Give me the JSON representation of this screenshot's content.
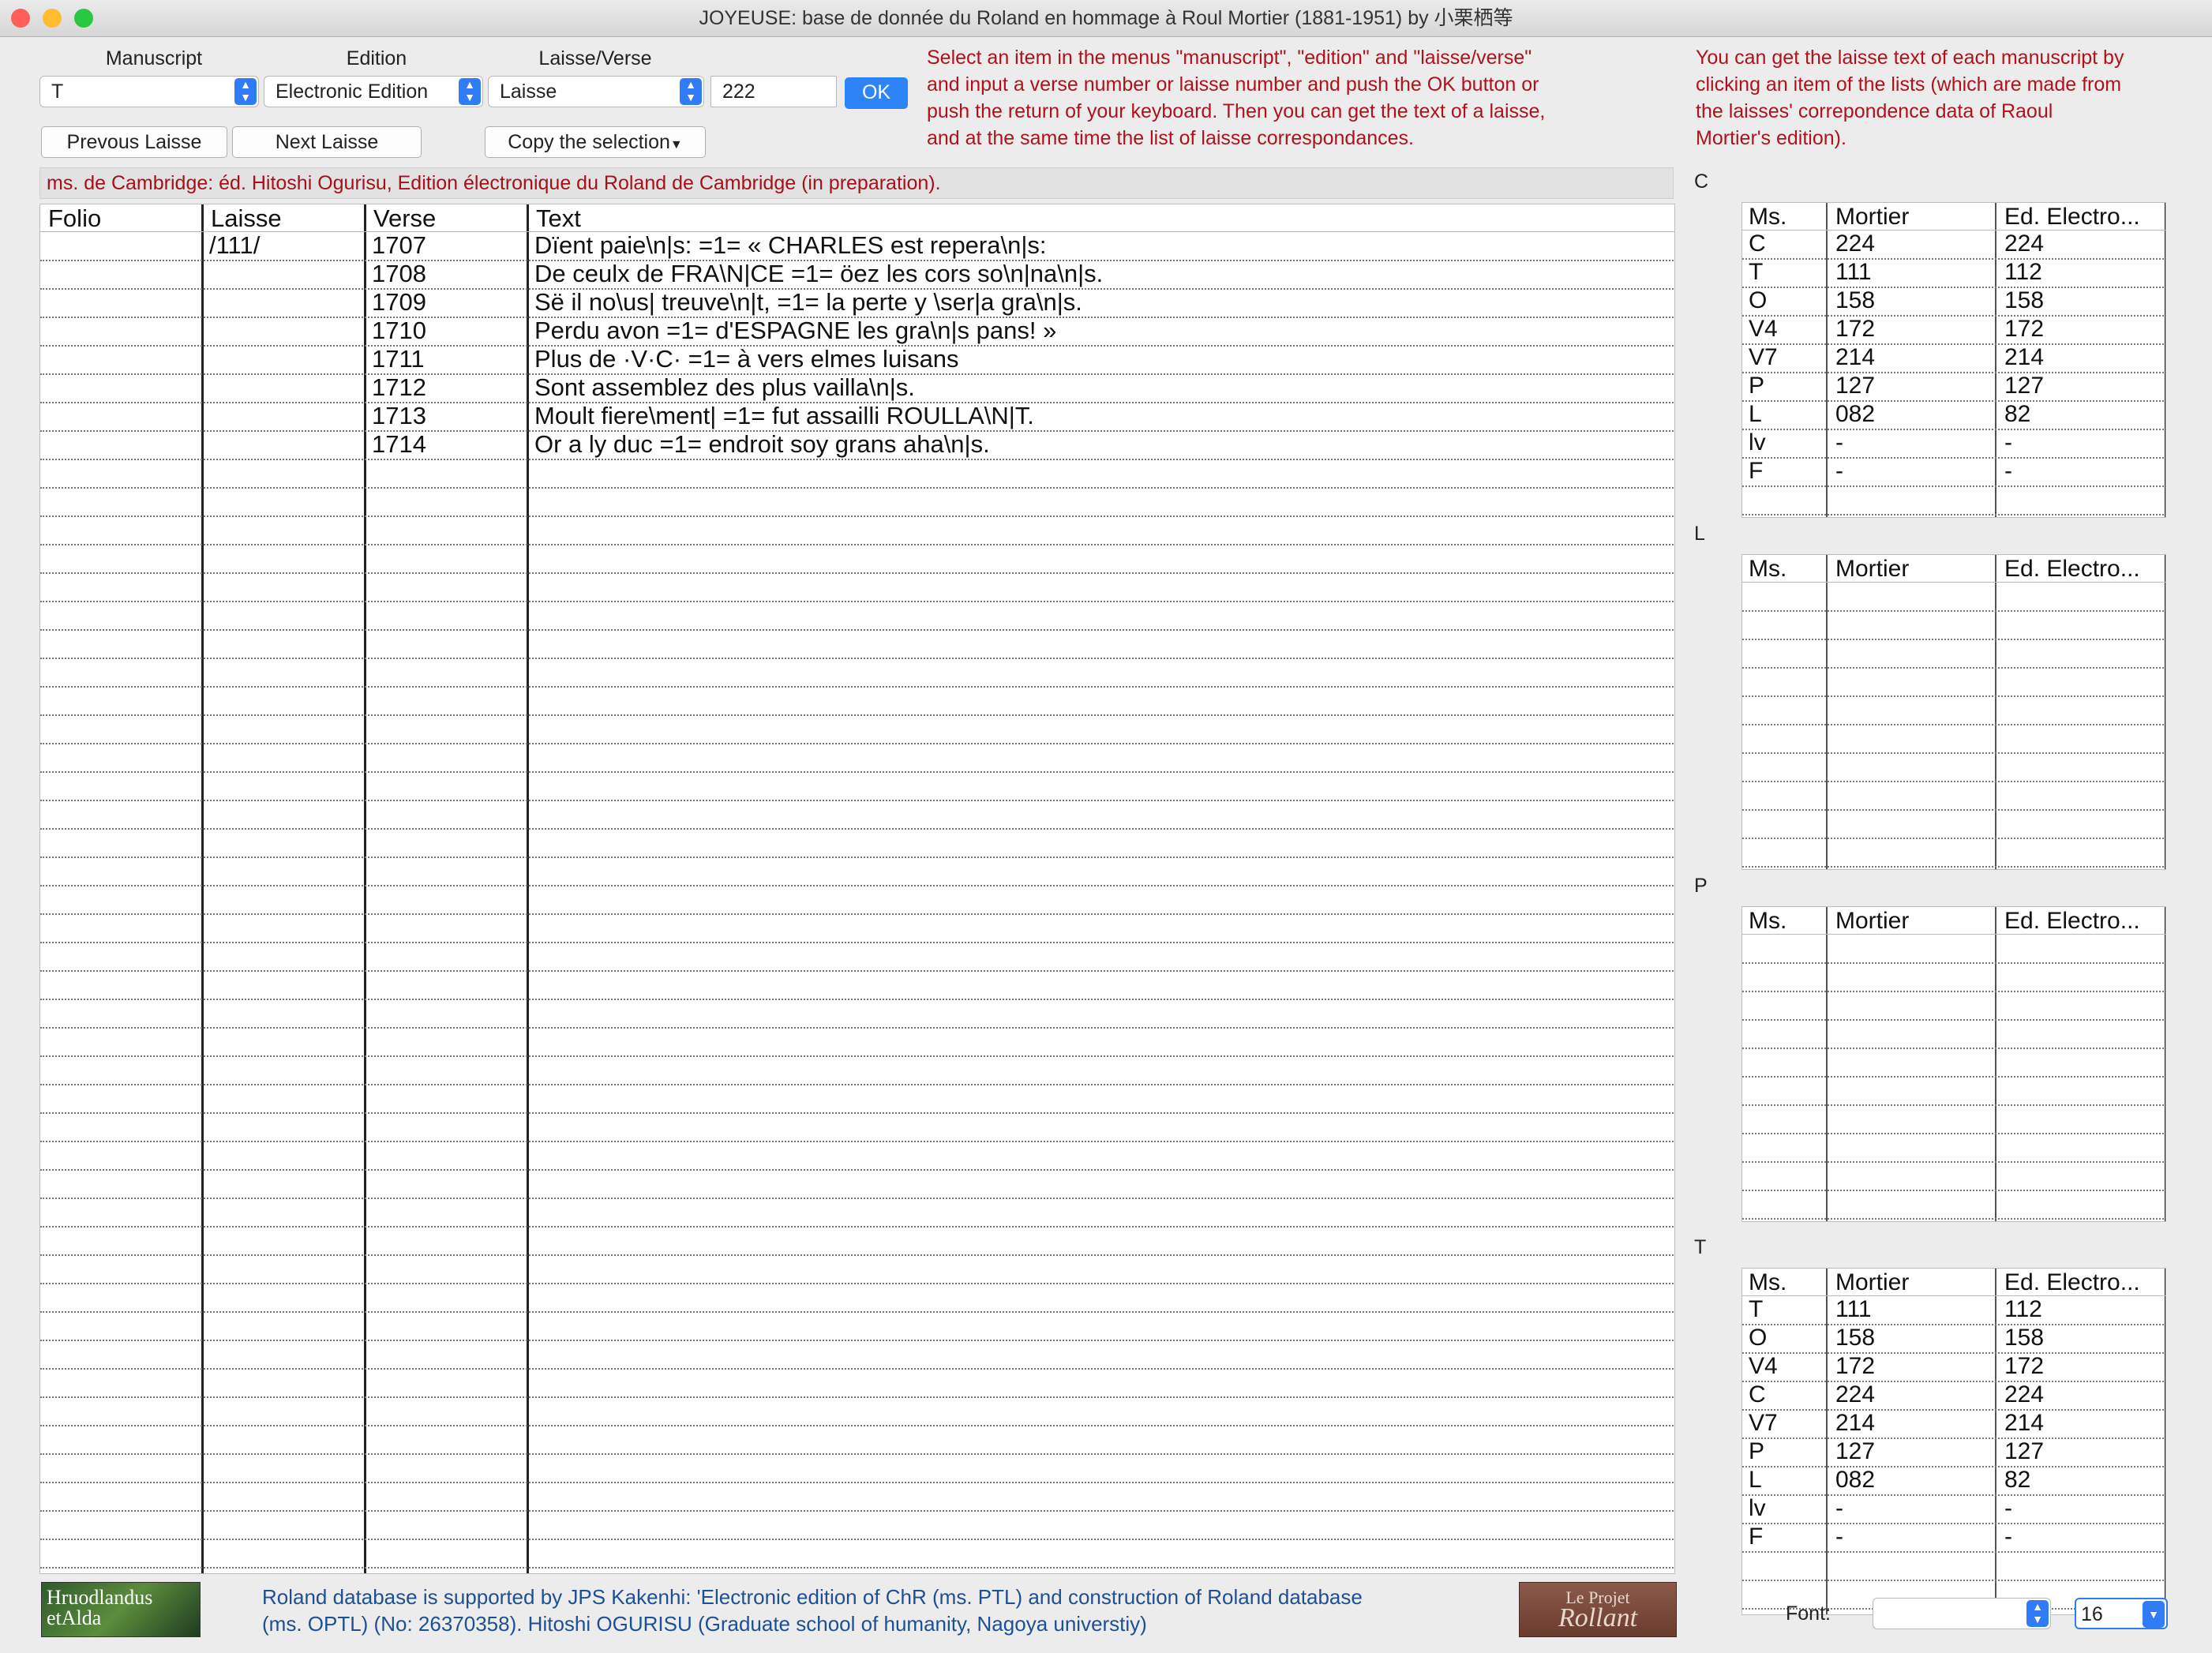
{
  "window": {
    "title": "JOYEUSE: base de donnée du Roland en hommage à Roul Mortier (1881-1951) by 小栗栖等",
    "traffic_colors": [
      "#fe5f57",
      "#febc2e",
      "#28c840"
    ]
  },
  "controls": {
    "manuscript_label": "Manuscript",
    "manuscript_value": "T",
    "edition_label": "Edition",
    "edition_value": "Electronic Edition",
    "laisse_label": "Laisse/Verse",
    "laisse_value": "Laisse",
    "number_value": "222",
    "ok_label": "OK",
    "prev_label": "Prevous Laisse",
    "next_label": "Next Laisse",
    "copy_label": "Copy the selection"
  },
  "help": {
    "left": [
      "Select an item in the menus \"manuscript\",  \"edition\" and \"laisse/verse\"",
      "and input a verse number or laisse number and push the OK button or",
      "push the return of your keyboard. Then you can get the text of a laisse,",
      "and at the same time the list of laisse correspondances."
    ],
    "right": [
      "You can get the laisse text of each manuscript by",
      "clicking an item of the lists (which are made from",
      "the laisses' correpondence data of Raoul",
      "Mortier's edition)."
    ]
  },
  "source": "ms. de Cambridge: éd. Hitoshi Ogurisu, Edition électronique du Roland de Cambridge (in preparation).",
  "table": {
    "headers": [
      "Folio",
      "Laisse",
      "Verse",
      "Text"
    ],
    "rows": [
      [
        "",
        "/111/",
        "1707",
        "Dïent paie\\n|s:  =1= « CHARLES est repera\\n|s:"
      ],
      [
        "",
        "",
        "1708",
        "De ceulx de FRA\\N|CE =1=  öez les cors so\\n|na\\n|s."
      ],
      [
        "",
        "",
        "1709",
        "Së il no\\us| treuve\\n|t, =1=  la perte y \\ser|a gra\\n|s."
      ],
      [
        "",
        "",
        "1710",
        "Perdu avon  =1= d'ESPAGNE les gra\\n|s pans! »"
      ],
      [
        "",
        "",
        "1711",
        "Plus de ·V·C· =1=  à vers elmes luisans"
      ],
      [
        "",
        "",
        "1712",
        "Sont assemblez des plus vailla\\n|s."
      ],
      [
        "",
        "",
        "1713",
        "Moult fiere\\ment|  =1= fut assailli ROULLA\\N|T."
      ],
      [
        "",
        "",
        "1714",
        "Or a ly duc =1= endroit soy grans aha\\n|s."
      ]
    ]
  },
  "side_tables": [
    {
      "label": "C",
      "headers": [
        "Ms.",
        "Mortier",
        "Ed. Electro..."
      ],
      "rows": [
        [
          "C",
          "224",
          "224"
        ],
        [
          "T",
          "111",
          "112"
        ],
        [
          "O",
          "158",
          "158"
        ],
        [
          "V4",
          "172",
          "172"
        ],
        [
          "V7",
          "214",
          "214"
        ],
        [
          "P",
          "127",
          "127"
        ],
        [
          "L",
          "082",
          "82"
        ],
        [
          "lv",
          "-",
          "-"
        ],
        [
          "F",
          "-",
          "-"
        ]
      ]
    },
    {
      "label": "L",
      "headers": [
        "Ms.",
        "Mortier",
        "Ed. Electro..."
      ],
      "rows": []
    },
    {
      "label": "P",
      "headers": [
        "Ms.",
        "Mortier",
        "Ed. Electro..."
      ],
      "rows": []
    },
    {
      "label": "T",
      "headers": [
        "Ms.",
        "Mortier",
        "Ed. Electro..."
      ],
      "rows": [
        [
          "T",
          "111",
          "112"
        ],
        [
          "O",
          "158",
          "158"
        ],
        [
          "V4",
          "172",
          "172"
        ],
        [
          "C",
          "224",
          "224"
        ],
        [
          "V7",
          "214",
          "214"
        ],
        [
          "P",
          "127",
          "127"
        ],
        [
          "L",
          "082",
          "82"
        ],
        [
          "lv",
          "-",
          "-"
        ],
        [
          "F",
          "-",
          "-"
        ]
      ]
    }
  ],
  "footer": {
    "logo_left": [
      "Hruodlandus",
      "etAlda"
    ],
    "line1": "Roland database is supported by JPS Kakenhi:  'Electronic edition of ChR (ms. PTL) and construction of Roland database",
    "line2": "(ms. OPTL) (No: 26370358). Hitoshi OGURISU (Graduate school of humanity, Nagoya universtiy)",
    "logo_right": [
      "Le Projet",
      "Rollant"
    ],
    "font_label": "Font:",
    "font_value": "",
    "size_value": "16"
  }
}
